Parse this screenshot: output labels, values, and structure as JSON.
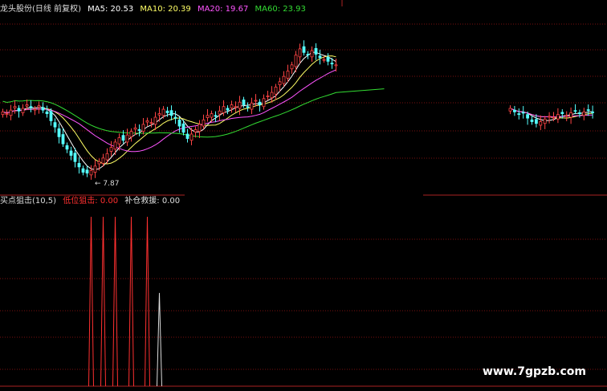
{
  "header": {
    "stock_name": "龙头股份(日线 前复权)",
    "ma5_label": "MA5: 20.53",
    "ma10_label": "MA10: 20.39",
    "ma20_label": "MA20: 19.67",
    "ma60_label": "MA60: 23.93"
  },
  "indicator": {
    "name": "买点狙击(10,5)",
    "sig1_label": "低位狙击: 0.00",
    "sig2_label": "补仓救援: 0.00"
  },
  "low_marker": "7.87",
  "watermark": "www.7gpzb.com",
  "colors": {
    "ma5": "#ffffff",
    "ma10": "#ffff66",
    "ma20": "#ff55ff",
    "ma60": "#33dd33",
    "up": "#ff4444",
    "down": "#55ffff",
    "grid": "#7a1010",
    "signal_red": "#ff3030",
    "signal_white": "#dddddd"
  },
  "chart_data": {
    "type": "candlestick",
    "low_price": 7.87,
    "ma_latest": {
      "MA5": 20.53,
      "MA10": 20.39,
      "MA20": 19.67,
      "MA60": 23.93
    },
    "segments": [
      {
        "name": "left",
        "count": 84,
        "closes": [
          15.2,
          15.0,
          15.4,
          15.8,
          15.3,
          15.6,
          16.0,
          15.7,
          15.5,
          15.9,
          15.4,
          15.0,
          14.2,
          13.5,
          12.4,
          11.6,
          11.0,
          10.3,
          9.6,
          9.0,
          8.4,
          8.3,
          8.6,
          9.1,
          9.6,
          10.0,
          10.5,
          11.2,
          11.8,
          12.3,
          12.0,
          12.6,
          13.0,
          13.4,
          13.2,
          13.8,
          14.2,
          14.0,
          14.6,
          15.0,
          15.5,
          15.1,
          14.8,
          14.5,
          13.6,
          12.9,
          12.2,
          12.7,
          13.2,
          13.8,
          14.3,
          14.8,
          15.0,
          14.7,
          15.3,
          15.8,
          15.4,
          16.0,
          15.8,
          16.3,
          16.0,
          15.7,
          16.2,
          16.5,
          16.0,
          16.7,
          17.0,
          17.4,
          18.0,
          18.6,
          19.2,
          19.8,
          20.5,
          21.6,
          22.3,
          21.9,
          21.6,
          22.1,
          21.7,
          21.3,
          21.1,
          20.9,
          20.6,
          20.5
        ]
      },
      {
        "name": "right",
        "count": 20,
        "closes": [
          15.6,
          15.2,
          14.9,
          15.1,
          14.5,
          14.1,
          13.9,
          14.1,
          14.4,
          14.7,
          14.6,
          14.9,
          15.0,
          14.8,
          15.1,
          15.3,
          15.0,
          15.2,
          15.4,
          15.2
        ]
      }
    ],
    "signals": [
      {
        "series": "低位狙击",
        "color": "red",
        "bar_index": 22,
        "value": 1.0
      },
      {
        "series": "低位狙击",
        "color": "red",
        "bar_index": 25,
        "value": 1.0
      },
      {
        "series": "低位狙击",
        "color": "red",
        "bar_index": 28,
        "value": 1.0
      },
      {
        "series": "低位狙击",
        "color": "red",
        "bar_index": 32,
        "value": 1.0
      },
      {
        "series": "低位狙击",
        "color": "red",
        "bar_index": 36,
        "value": 1.0
      },
      {
        "series": "补仓救援",
        "color": "white",
        "bar_index": 39,
        "value": 0.55
      }
    ]
  }
}
